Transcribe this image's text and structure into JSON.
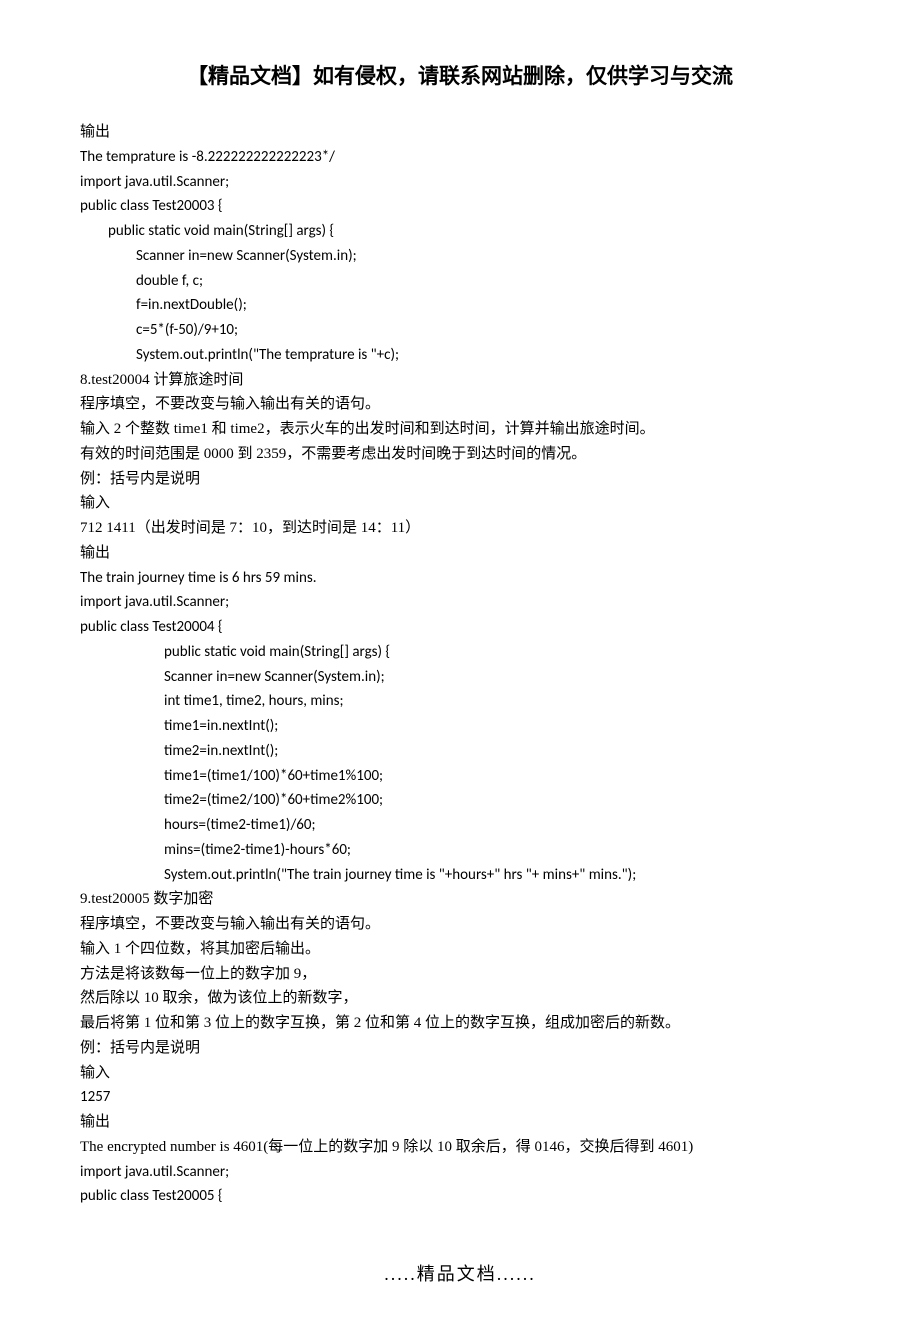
{
  "header": "【精品文档】如有侵权，请联系网站删除，仅供学习与交流",
  "footer": ".....精品文档......",
  "lines": [
    {
      "text": "输出",
      "indent": 0,
      "cn": true
    },
    {
      "text": "The temprature is -8.222222222222223*/",
      "indent": 0
    },
    {
      "text": "import java.util.Scanner;",
      "indent": 0
    },
    {
      "text": "public class Test20003 {",
      "indent": 0
    },
    {
      "text": "public static void main(String[] args) {",
      "indent": 1
    },
    {
      "text": "Scanner in=new Scanner(System.in);",
      "indent": 2
    },
    {
      "text": "double f, c;",
      "indent": 2
    },
    {
      "text": "f=in.nextDouble();",
      "indent": 2
    },
    {
      "text": "c=5*(f-50)/9+10;",
      "indent": 2
    },
    {
      "text": "System.out.println(\"The temprature is \"+c);",
      "indent": 2
    },
    {
      "text": "8.test20004 计算旅途时间",
      "indent": 0,
      "cn": true
    },
    {
      "text": "程序填空，不要改变与输入输出有关的语句。",
      "indent": 0,
      "cn": true
    },
    {
      "text": "输入 2 个整数 time1 和 time2，表示火车的出发时间和到达时间，计算并输出旅途时间。",
      "indent": 0,
      "cn": true
    },
    {
      "text": "有效的时间范围是 0000 到 2359，不需要考虑出发时间晚于到达时间的情况。",
      "indent": 0,
      "cn": true
    },
    {
      "text": "例：括号内是说明",
      "indent": 0,
      "cn": true
    },
    {
      "text": "输入",
      "indent": 0,
      "cn": true
    },
    {
      "text": "712 1411（出发时间是 7：10，到达时间是 14：11）",
      "indent": 0,
      "cn": true
    },
    {
      "text": "输出",
      "indent": 0,
      "cn": true
    },
    {
      "text": "The train journey time is 6 hrs 59 mins.",
      "indent": 0
    },
    {
      "text": "import java.util.Scanner;",
      "indent": 0
    },
    {
      "text": "public class Test20004 {",
      "indent": 0
    },
    {
      "text": "public static void main(String[] args) {",
      "indent": 3
    },
    {
      "text": "Scanner in=new Scanner(System.in);",
      "indent": 3
    },
    {
      "text": "int time1, time2, hours, mins;",
      "indent": 3
    },
    {
      "text": "time1=in.nextInt();",
      "indent": 3
    },
    {
      "text": "time2=in.nextInt();",
      "indent": 3
    },
    {
      "text": "time1=(time1/100)*60+time1%100;",
      "indent": 3
    },
    {
      "text": "time2=(time2/100)*60+time2%100;",
      "indent": 3
    },
    {
      "text": "hours=(time2-time1)/60;",
      "indent": 3
    },
    {
      "text": "mins=(time2-time1)-hours*60;",
      "indent": 3
    },
    {
      "text": "System.out.println(\"The train journey time is \"+hours+\" hrs \"+ mins+\" mins.\");",
      "indent": 3
    },
    {
      "text": "9.test20005 数字加密",
      "indent": 0,
      "cn": true
    },
    {
      "text": "程序填空，不要改变与输入输出有关的语句。",
      "indent": 0,
      "cn": true
    },
    {
      "text": "输入 1 个四位数，将其加密后输出。",
      "indent": 0,
      "cn": true
    },
    {
      "text": "方法是将该数每一位上的数字加 9，",
      "indent": 0,
      "cn": true
    },
    {
      "text": "然后除以 10 取余，做为该位上的新数字，",
      "indent": 0,
      "cn": true
    },
    {
      "text": "最后将第 1 位和第 3 位上的数字互换，第 2 位和第 4 位上的数字互换，组成加密后的新数。",
      "indent": 0,
      "cn": true
    },
    {
      "text": "例：括号内是说明",
      "indent": 0,
      "cn": true
    },
    {
      "text": "输入",
      "indent": 0,
      "cn": true
    },
    {
      "text": "1257",
      "indent": 0
    },
    {
      "text": "输出",
      "indent": 0,
      "cn": true
    },
    {
      "text": "The encrypted number is 4601(每一位上的数字加 9 除以 10 取余后，得 0146，交换后得到 4601)",
      "indent": 0,
      "cn": true
    },
    {
      "text": "import java.util.Scanner;",
      "indent": 0
    },
    {
      "text": "public class Test20005 {",
      "indent": 0
    }
  ]
}
